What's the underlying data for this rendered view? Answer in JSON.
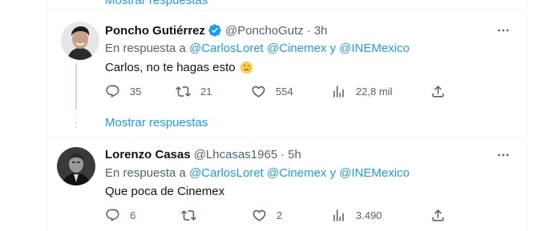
{
  "colors": {
    "accent": "#1d9bf0",
    "secondary_text": "#536471",
    "primary_text": "#0f1419",
    "border": "#eff3f4"
  },
  "top": {
    "show_replies_label": "Mostrar respuestas"
  },
  "tweets": [
    {
      "name": "Poncho Gutiérrez",
      "verified": true,
      "handle": "@PonchoGutz",
      "separator": "·",
      "time": "3h",
      "reply_prefix": "En respuesta a",
      "mention_1": "@CarlosLoret",
      "mention_2": "@Cinemex",
      "mention_joiner": "y",
      "mention_3": "@INEMexico",
      "text": "Carlos, no te hagas esto",
      "emoji": "crying-face",
      "replies": "35",
      "retweets": "21",
      "likes": "554",
      "views": "22,8 mil"
    },
    {
      "name": "Lorenzo Casas",
      "verified": false,
      "handle": "@Lhcasas1965",
      "separator": "·",
      "time": "5h",
      "reply_prefix": "En respuesta a",
      "mention_1": "@CarlosLoret",
      "mention_2": "@Cinemex",
      "mention_joiner": "y",
      "mention_3": "@INEMexico",
      "text": "Que poca de Cinemex",
      "replies": "6",
      "retweets": "",
      "likes": "2",
      "views": "3.490"
    }
  ],
  "thread": {
    "show_replies_label": "Mostrar respuestas"
  }
}
